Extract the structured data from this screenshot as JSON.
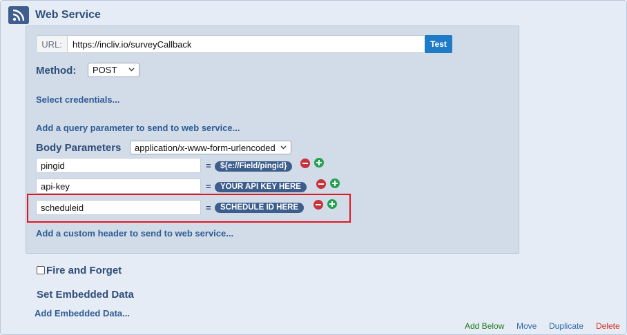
{
  "header": {
    "title": "Web Service",
    "icon": "rss-icon"
  },
  "url": {
    "label": "URL:",
    "value": "https://incliv.io/surveyCallback",
    "test_label": "Test"
  },
  "method": {
    "label": "Method:",
    "selected": "POST"
  },
  "links": {
    "select_credentials": "Select credentials...",
    "add_query_param": "Add a query parameter to send to web service...",
    "add_custom_header": "Add a custom header to send to web service..."
  },
  "body_params": {
    "label": "Body Parameters",
    "content_type": "application/x-www-form-urlencoded",
    "rows": [
      {
        "key": "pingid",
        "value": "${e://Field/pingid}"
      },
      {
        "key": "api-key",
        "value": "YOUR API KEY HERE"
      },
      {
        "key": "scheduleid",
        "value": "SCHEDULE ID HERE"
      }
    ],
    "equals": "="
  },
  "fire_and_forget": {
    "label": "Fire and Forget",
    "checked": false
  },
  "embedded": {
    "title": "Set Embedded Data",
    "add_label": "Add Embedded Data..."
  },
  "actions": {
    "add_below": {
      "label": "Add Below",
      "color": "#1f7a1f"
    },
    "move": {
      "label": "Move",
      "color": "#2e6ba8"
    },
    "duplicate": {
      "label": "Duplicate",
      "color": "#2e6ba8"
    },
    "delete": {
      "label": "Delete",
      "color": "#d03020"
    }
  },
  "colors": {
    "accent": "#1f7bc6",
    "highlight": "#e0171f",
    "pill": "#3d5e8c"
  }
}
